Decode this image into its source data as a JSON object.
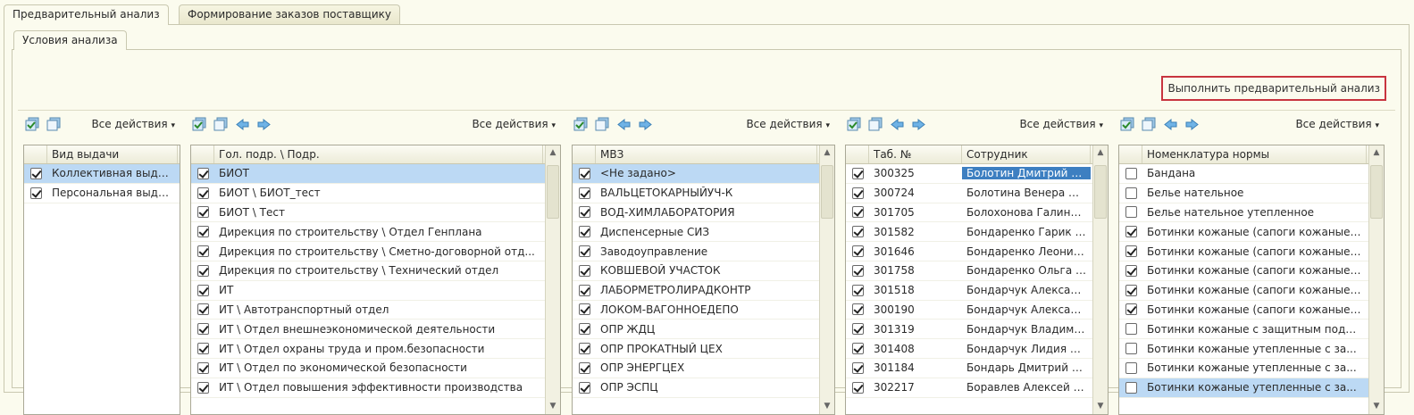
{
  "tabs": [
    "Предварительный анализ",
    "Формирование заказов поставщику"
  ],
  "subtab": "Условия анализа",
  "run_button": "Выполнить предварительный анализ",
  "all_actions": "Все действия",
  "grids": [
    {
      "headers": [
        "Вид выдачи"
      ],
      "rows": [
        {
          "checked": true,
          "sel": true,
          "c": [
            "Коллективная выда..."
          ]
        },
        {
          "checked": true,
          "c": [
            "Персональная выда..."
          ]
        }
      ]
    },
    {
      "headers": [
        "Гол. подр. \\ Подр."
      ],
      "rows": [
        {
          "checked": true,
          "sel": true,
          "c": [
            "БИОТ"
          ]
        },
        {
          "checked": true,
          "c": [
            "БИОТ \\ БИОТ_тест"
          ]
        },
        {
          "checked": true,
          "c": [
            "БИОТ \\ Тест"
          ]
        },
        {
          "checked": true,
          "c": [
            "Дирекция по строительству \\ Отдел Генплана"
          ]
        },
        {
          "checked": true,
          "c": [
            "Дирекция по строительству \\ Сметно-договорной отд..."
          ]
        },
        {
          "checked": true,
          "c": [
            "Дирекция по строительству \\ Технический отдел"
          ]
        },
        {
          "checked": true,
          "c": [
            "ИТ"
          ]
        },
        {
          "checked": true,
          "c": [
            "ИТ \\ Автотранспортный отдел"
          ]
        },
        {
          "checked": true,
          "c": [
            "ИТ \\ Отдел внешнеэкономической деятельности"
          ]
        },
        {
          "checked": true,
          "c": [
            "ИТ \\ Отдел охраны труда и пром.безопасности"
          ]
        },
        {
          "checked": true,
          "c": [
            "ИТ \\ Отдел по экономической безопасности"
          ]
        },
        {
          "checked": true,
          "c": [
            "ИТ \\ Отдел повышения эффективности производства"
          ]
        }
      ]
    },
    {
      "headers": [
        "МВЗ"
      ],
      "rows": [
        {
          "checked": true,
          "sel": true,
          "c": [
            "<Не задано>"
          ]
        },
        {
          "checked": true,
          "c": [
            "ВАЛЬЦЕТОКАРНЫЙУЧ-К"
          ]
        },
        {
          "checked": true,
          "c": [
            "ВОД-ХИМЛАБОРАТОРИЯ"
          ]
        },
        {
          "checked": true,
          "c": [
            "Диспенсерные СИЗ"
          ]
        },
        {
          "checked": true,
          "c": [
            "Заводоуправление"
          ]
        },
        {
          "checked": true,
          "c": [
            "КОВШЕВОЙ УЧАСТОК"
          ]
        },
        {
          "checked": true,
          "c": [
            "ЛАБОРМЕТРОЛИРАДКОНТР"
          ]
        },
        {
          "checked": true,
          "c": [
            "ЛОКОМ-ВАГОННОЕДЕПО"
          ]
        },
        {
          "checked": true,
          "c": [
            "ОПР ЖДЦ"
          ]
        },
        {
          "checked": true,
          "c": [
            "ОПР ПРОКАТНЫЙ ЦЕХ"
          ]
        },
        {
          "checked": true,
          "c": [
            "ОПР ЭНЕРГЦЕХ"
          ]
        },
        {
          "checked": true,
          "c": [
            "ОПР ЭСПЦ"
          ]
        }
      ]
    },
    {
      "headers": [
        "Таб. №",
        "Сотрудник"
      ],
      "rows": [
        {
          "checked": true,
          "c": [
            "300325",
            "Болотин Дмитрий Вла..."
          ],
          "selcell": 1
        },
        {
          "checked": true,
          "c": [
            "300724",
            "Болотина Венера Мах..."
          ]
        },
        {
          "checked": true,
          "c": [
            "301705",
            "Болохонова Галина М..."
          ]
        },
        {
          "checked": true,
          "c": [
            "301582",
            "Бондаренко Гарик Гр..."
          ]
        },
        {
          "checked": true,
          "c": [
            "301646",
            "Бондаренко Леонид ..."
          ]
        },
        {
          "checked": true,
          "c": [
            "301758",
            "Бондаренко Ольга Ви..."
          ]
        },
        {
          "checked": true,
          "c": [
            "301518",
            "Бондарчук Александ..."
          ]
        },
        {
          "checked": true,
          "c": [
            "300190",
            "Бондарчук Александ..."
          ]
        },
        {
          "checked": true,
          "c": [
            "301319",
            "Бондарчук Владимир ..."
          ]
        },
        {
          "checked": true,
          "c": [
            "301408",
            "Бондарчук Лидия Ник..."
          ]
        },
        {
          "checked": true,
          "c": [
            "301184",
            "Бондарь Дмитрий Ник..."
          ]
        },
        {
          "checked": true,
          "c": [
            "302217",
            "Боравлев Алексей Пе..."
          ]
        }
      ]
    },
    {
      "headers": [
        "Номенклатура нормы"
      ],
      "rows": [
        {
          "checked": false,
          "c": [
            "Бандана"
          ]
        },
        {
          "checked": false,
          "c": [
            "Белье нательное"
          ]
        },
        {
          "checked": false,
          "c": [
            "Белье нательное утепленное"
          ]
        },
        {
          "checked": true,
          "c": [
            "Ботинки кожаные  (сапоги кожаные)..."
          ]
        },
        {
          "checked": true,
          "c": [
            "Ботинки кожаные (сапоги кожаные) ..."
          ]
        },
        {
          "checked": true,
          "c": [
            "Ботинки кожаные (сапоги кожаные) ..."
          ]
        },
        {
          "checked": true,
          "c": [
            "Ботинки кожаные (сапоги кожаные) ..."
          ]
        },
        {
          "checked": true,
          "c": [
            "Ботинки кожаные (сапоги кожаные) ..."
          ]
        },
        {
          "checked": false,
          "c": [
            "Ботинки кожаные с защитным подн..."
          ]
        },
        {
          "checked": false,
          "c": [
            "Ботинки кожаные утепленные с за..."
          ]
        },
        {
          "checked": false,
          "c": [
            "Ботинки кожаные утепленные с за..."
          ]
        },
        {
          "checked": false,
          "sel": true,
          "c": [
            "Ботинки кожаные утепленные с за..."
          ]
        }
      ]
    }
  ]
}
